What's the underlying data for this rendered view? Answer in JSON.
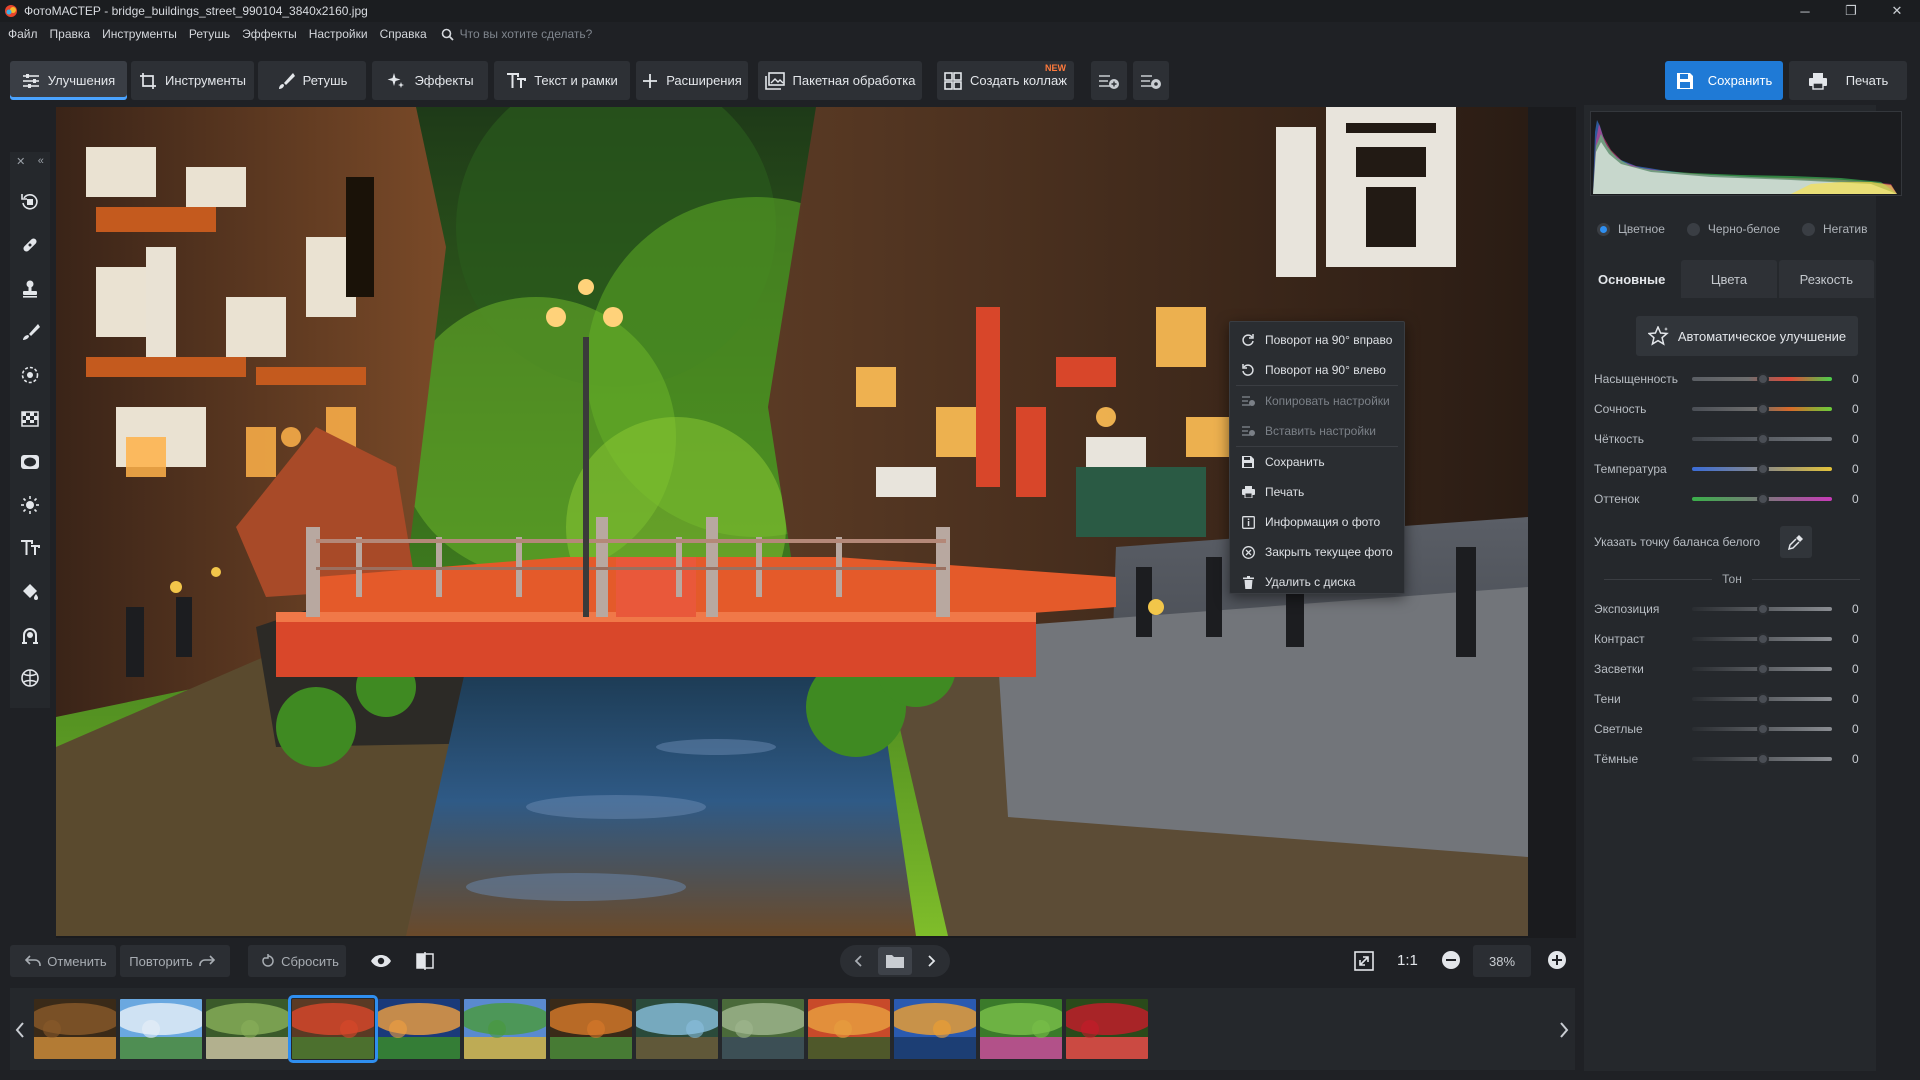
{
  "window": {
    "title": "ФотоМАСТЕР - bridge_buildings_street_990104_3840x2160.jpg",
    "minimize": "─",
    "maximize": "❐",
    "close": "✕"
  },
  "menu": {
    "items": [
      "Файл",
      "Правка",
      "Инструменты",
      "Ретушь",
      "Эффекты",
      "Настройки",
      "Справка"
    ],
    "search_placeholder": "Что вы хотите сделать?"
  },
  "toolbar": {
    "tabs": [
      {
        "label": "Улучшения",
        "icon": "sliders-icon",
        "active": true
      },
      {
        "label": "Инструменты",
        "icon": "crop-icon"
      },
      {
        "label": "Ретушь",
        "icon": "brush-icon"
      },
      {
        "label": "Эффекты",
        "icon": "sparkle-icon"
      },
      {
        "label": "Текст и рамки",
        "icon": "text-icon"
      },
      {
        "label": "Расширения",
        "icon": "plus-icon"
      },
      {
        "label": "Пакетная обработка",
        "icon": "images-icon"
      },
      {
        "label": "Создать коллаж",
        "icon": "collage-icon",
        "badge": "NEW"
      }
    ],
    "save_label": "Сохранить",
    "print_label": "Печать"
  },
  "left_tools": [
    "rotate-icon",
    "healing-icon",
    "stamp-icon",
    "brush-icon",
    "radial-filter-icon",
    "gradient-icon",
    "vignette-icon",
    "light-icon",
    "text-icon",
    "fill-icon",
    "portrait-icon",
    "globe-icon"
  ],
  "context_menu": {
    "items": [
      {
        "label": "Поворот на 90° вправо",
        "icon": "rotate-right-icon",
        "disabled": false
      },
      {
        "label": "Поворот на 90° влево",
        "icon": "rotate-left-icon",
        "disabled": false
      },
      {
        "label": "Копировать настройки",
        "icon": "copy-settings-icon",
        "disabled": true
      },
      {
        "label": "Вставить настройки",
        "icon": "paste-settings-icon",
        "disabled": true
      },
      {
        "label": "Сохранить",
        "icon": "save-icon",
        "disabled": false
      },
      {
        "label": "Печать",
        "icon": "print-icon",
        "disabled": false
      },
      {
        "label": "Информация о фото",
        "icon": "info-icon",
        "disabled": false
      },
      {
        "label": "Закрыть текущее фото",
        "icon": "close-circle-icon",
        "disabled": false
      },
      {
        "label": "Удалить с диска",
        "icon": "trash-icon",
        "disabled": false
      }
    ]
  },
  "bottom": {
    "undo": "Отменить",
    "redo": "Повторить",
    "reset": "Сбросить",
    "zoom_1to1": "1:1",
    "zoom_value": "38%"
  },
  "filmstrip": {
    "count": 13,
    "selected_index": 3
  },
  "right_panel": {
    "modes": [
      {
        "label": "Цветное",
        "selected": true
      },
      {
        "label": "Черно-белое",
        "selected": false
      },
      {
        "label": "Негатив",
        "selected": false
      }
    ],
    "tabs": [
      {
        "label": "Основные",
        "active": true
      },
      {
        "label": "Цвета",
        "active": false
      },
      {
        "label": "Резкость",
        "active": false
      }
    ],
    "auto_button": "Автоматическое улучшение",
    "sliders_main": [
      {
        "label": "Насыщенность",
        "value": "0",
        "gradient": "linear-gradient(90deg,#5a5e64,#6e6e6e 40%,#e04a3a 70%,#4ad04a)"
      },
      {
        "label": "Сочность",
        "value": "0",
        "gradient": "linear-gradient(90deg,#4a4e55,#6e6e6e 45%,#d86a2a 70%,#6acd3a)"
      },
      {
        "label": "Чёткость",
        "value": "0",
        "gradient": "linear-gradient(90deg,#3f4349,#72767c)"
      },
      {
        "label": "Температура",
        "value": "0",
        "gradient": "linear-gradient(90deg,#3a6cd8,#8a8a8a 50%,#e3c33a)"
      },
      {
        "label": "Оттенок",
        "value": "0",
        "gradient": "linear-gradient(90deg,#3ab04a,#7a7a7a 50%,#c83ab8)"
      }
    ],
    "white_balance_label": "Указать точку баланса белого",
    "tone_header": "Тон",
    "sliders_tone": [
      {
        "label": "Экспозиция",
        "value": "0",
        "gradient": "linear-gradient(90deg,#2a2d31,#8a8d92)"
      },
      {
        "label": "Контраст",
        "value": "0",
        "gradient": "linear-gradient(90deg,#2a2d31,#8a8d92)"
      },
      {
        "label": "Засветки",
        "value": "0",
        "gradient": "linear-gradient(90deg,#2a2d31,#8a8d92)"
      },
      {
        "label": "Тени",
        "value": "0",
        "gradient": "linear-gradient(90deg,#2a2d31,#8a8d92)"
      },
      {
        "label": "Светлые",
        "value": "0",
        "gradient": "linear-gradient(90deg,#2a2d31,#8a8d92)"
      },
      {
        "label": "Тёмные",
        "value": "0",
        "gradient": "linear-gradient(90deg,#2a2d31,#8a8d92)"
      }
    ]
  },
  "colors": {
    "accent": "#2f8ff0",
    "save_button": "#1f7ad6",
    "new_badge": "#ff7a3c",
    "bridge_red": "#d9472a"
  }
}
